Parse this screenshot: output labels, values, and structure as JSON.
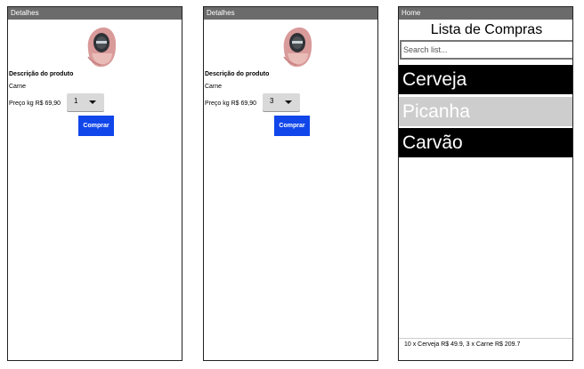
{
  "details_screens": [
    {
      "window_title": "Detalhes",
      "description_heading": "Descrição do produto",
      "product_name": "Carne",
      "price_label": "Preço kg R$ 69,90",
      "quantity": "1",
      "buy_label": "Comprar"
    },
    {
      "window_title": "Detalhes",
      "description_heading": "Descrição do produto",
      "product_name": "Carne",
      "price_label": "Preço kg R$ 69,90",
      "quantity": "3",
      "buy_label": "Comprar"
    }
  ],
  "home": {
    "window_title": "Home",
    "list_title": "Lista de Compras",
    "search_placeholder": "Search list...",
    "items": [
      "Cerveja",
      "Picanha",
      "Carvão"
    ],
    "cart_summary": "10 x Cerveja R$ 49.9, 3 x Carne R$ 209.7"
  },
  "colors": {
    "titlebar": "#6b6b6b",
    "buy_button": "#1146ea",
    "item_dark": "#000000",
    "item_selected": "#cdcdcd"
  }
}
